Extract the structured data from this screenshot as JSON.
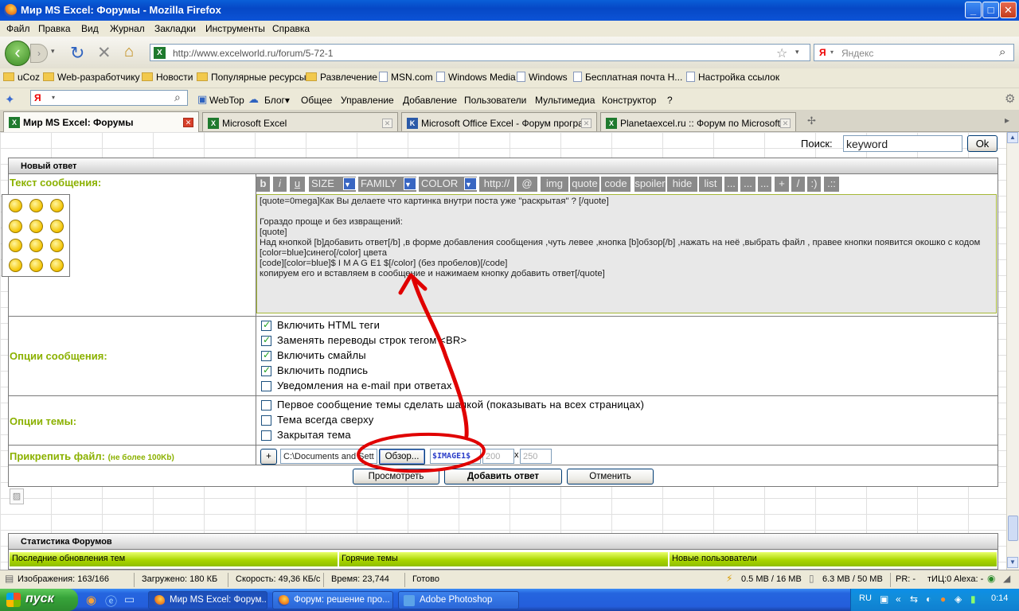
{
  "window": {
    "title": "Мир MS Excel: Форумы - Mozilla Firefox",
    "min": "_",
    "max": "□",
    "close": "✕"
  },
  "menu": [
    "Файл",
    "Правка",
    "Вид",
    "Журнал",
    "Закладки",
    "Инструменты",
    "Справка"
  ],
  "nav": {
    "url": "http://www.excelworld.ru/forum/5-72-1",
    "search_placeholder": "Яндекс",
    "yandex_logo": "Я"
  },
  "bookmarks": [
    "uCoz",
    "Web-разработчику",
    "Новости",
    "Популярные ресурсы",
    "Развлечение",
    "MSN.com",
    "Windows Media",
    "Windows",
    "Бесплатная почта Н...",
    "Настройка ссылок"
  ],
  "yandex_bar": {
    "logo": "Я",
    "items": [
      "WebTop",
      "Блог▾",
      "Общее",
      "Управление",
      "Добавление",
      "Пользователи",
      "Мультимедиа",
      "Конструктор",
      "?"
    ]
  },
  "tabs": [
    {
      "label": "Мир MS Excel: Форумы",
      "icon": "X"
    },
    {
      "label": "Microsoft Excel",
      "icon": "X"
    },
    {
      "label": "Microsoft Office Excel - Форум програ...",
      "icon": "K"
    },
    {
      "label": "Planetaexcel.ru :: Форум по Microsoft ...",
      "icon": "X"
    }
  ],
  "search": {
    "label": "Поиск:",
    "value": "keyword",
    "button": "Ok"
  },
  "form": {
    "header": "Новый ответ",
    "text_label": "Текст сообщения:",
    "toolbar": [
      "b",
      "i",
      "u",
      "SIZE",
      "FAMILY",
      "COLOR",
      "http://",
      "@",
      "img",
      "quote",
      "code",
      "spoiler",
      "hide",
      "list",
      "...",
      "...",
      "...",
      "+",
      "/",
      ":)",
      ".::"
    ],
    "message": "[quote=0mega]Как Вы делаете что картинка внутри поста уже \"раскрытая\" ? [/quote]\n\nГораздо проще и без извращений:\n[quote]\nНад кнопкой [b]добавить ответ[/b] ,в форме добавления сообщения ,чуть левее ,кнопка [b]обзор[/b] ,нажать на неё ,выбрать файл , правее кнопки появится окошко с кодом [color=blue]синего[/color] цвета\n[code][color=blue]$ I M A G E1 $[/color] (без пробелов)[/code]\nкопируем его и вставляем в сообщение и нажимаем кнопку добавить ответ[/quote]",
    "options_label": "Опции сообщения:",
    "options": [
      {
        "label": "Включить HTML теги",
        "checked": true
      },
      {
        "label": "Заменять переводы строк тегом <BR>",
        "checked": true
      },
      {
        "label": "Включить смайлы",
        "checked": true
      },
      {
        "label": "Включить подпись",
        "checked": true
      },
      {
        "label": "Уведомления на e-mail при ответах",
        "checked": false
      }
    ],
    "topic_label": "Опции темы:",
    "topic_options": [
      {
        "label": "Первое сообщение темы сделать шапкой (показывать на всех страницах)",
        "checked": false
      },
      {
        "label": "Тема всегда сверху",
        "checked": false
      },
      {
        "label": "Закрытая тема",
        "checked": false
      }
    ],
    "attach_label": "Прикрепить файл:",
    "attach_note": "(не более 100Kb)",
    "attach_plus": "+",
    "file_path": "C:\\Documents and Settings",
    "browse": "Обзор...",
    "image_code": "$IMAGE1$",
    "width": "200",
    "times": "x",
    "height": "250",
    "buttons": {
      "preview": "Просмотреть",
      "submit": "Добавить ответ",
      "cancel": "Отменить"
    }
  },
  "stats": {
    "header": "Статистика Форумов",
    "cols": [
      "Последние обновления тем",
      "Горячие темы",
      "Новые пользователи"
    ]
  },
  "status": {
    "images": "Изображения: 163/166",
    "loaded": "Загружено: 180 КБ",
    "speed": "Скорость: 49,36 КБ/с",
    "time": "Время: 23,744",
    "ready": "Готово",
    "mem1": "0.5 MB / 16 MB",
    "mem2": "6.3 MB / 50 MB",
    "pr": "PR: -",
    "tic": "тИЦ:0",
    "alexa": "Alexa: -"
  },
  "taskbar": {
    "start": "пуск",
    "tasks": [
      "Мир MS Excel: Форум...",
      "Форум: решение про...",
      "Adobe Photoshop"
    ],
    "lang": "RU",
    "clock": "0:14"
  },
  "annotation_color": "#e00000"
}
